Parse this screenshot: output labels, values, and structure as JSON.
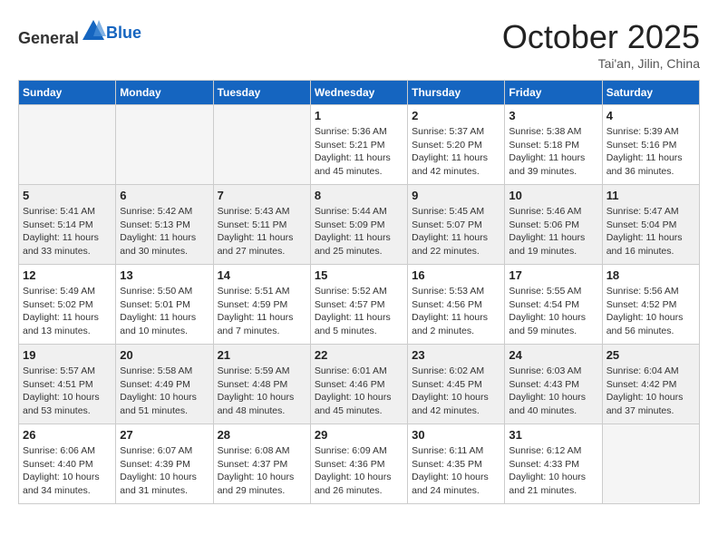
{
  "header": {
    "logo_general": "General",
    "logo_blue": "Blue",
    "month": "October 2025",
    "location": "Tai'an, Jilin, China"
  },
  "days_of_week": [
    "Sunday",
    "Monday",
    "Tuesday",
    "Wednesday",
    "Thursday",
    "Friday",
    "Saturday"
  ],
  "weeks": [
    [
      {
        "day": "",
        "sunrise": "",
        "sunset": "",
        "daylight": "",
        "empty": true
      },
      {
        "day": "",
        "sunrise": "",
        "sunset": "",
        "daylight": "",
        "empty": true
      },
      {
        "day": "",
        "sunrise": "",
        "sunset": "",
        "daylight": "",
        "empty": true
      },
      {
        "day": "1",
        "sunrise": "Sunrise: 5:36 AM",
        "sunset": "Sunset: 5:21 PM",
        "daylight": "Daylight: 11 hours and 45 minutes.",
        "empty": false
      },
      {
        "day": "2",
        "sunrise": "Sunrise: 5:37 AM",
        "sunset": "Sunset: 5:20 PM",
        "daylight": "Daylight: 11 hours and 42 minutes.",
        "empty": false
      },
      {
        "day": "3",
        "sunrise": "Sunrise: 5:38 AM",
        "sunset": "Sunset: 5:18 PM",
        "daylight": "Daylight: 11 hours and 39 minutes.",
        "empty": false
      },
      {
        "day": "4",
        "sunrise": "Sunrise: 5:39 AM",
        "sunset": "Sunset: 5:16 PM",
        "daylight": "Daylight: 11 hours and 36 minutes.",
        "empty": false
      }
    ],
    [
      {
        "day": "5",
        "sunrise": "Sunrise: 5:41 AM",
        "sunset": "Sunset: 5:14 PM",
        "daylight": "Daylight: 11 hours and 33 minutes.",
        "empty": false
      },
      {
        "day": "6",
        "sunrise": "Sunrise: 5:42 AM",
        "sunset": "Sunset: 5:13 PM",
        "daylight": "Daylight: 11 hours and 30 minutes.",
        "empty": false
      },
      {
        "day": "7",
        "sunrise": "Sunrise: 5:43 AM",
        "sunset": "Sunset: 5:11 PM",
        "daylight": "Daylight: 11 hours and 27 minutes.",
        "empty": false
      },
      {
        "day": "8",
        "sunrise": "Sunrise: 5:44 AM",
        "sunset": "Sunset: 5:09 PM",
        "daylight": "Daylight: 11 hours and 25 minutes.",
        "empty": false
      },
      {
        "day": "9",
        "sunrise": "Sunrise: 5:45 AM",
        "sunset": "Sunset: 5:07 PM",
        "daylight": "Daylight: 11 hours and 22 minutes.",
        "empty": false
      },
      {
        "day": "10",
        "sunrise": "Sunrise: 5:46 AM",
        "sunset": "Sunset: 5:06 PM",
        "daylight": "Daylight: 11 hours and 19 minutes.",
        "empty": false
      },
      {
        "day": "11",
        "sunrise": "Sunrise: 5:47 AM",
        "sunset": "Sunset: 5:04 PM",
        "daylight": "Daylight: 11 hours and 16 minutes.",
        "empty": false
      }
    ],
    [
      {
        "day": "12",
        "sunrise": "Sunrise: 5:49 AM",
        "sunset": "Sunset: 5:02 PM",
        "daylight": "Daylight: 11 hours and 13 minutes.",
        "empty": false
      },
      {
        "day": "13",
        "sunrise": "Sunrise: 5:50 AM",
        "sunset": "Sunset: 5:01 PM",
        "daylight": "Daylight: 11 hours and 10 minutes.",
        "empty": false
      },
      {
        "day": "14",
        "sunrise": "Sunrise: 5:51 AM",
        "sunset": "Sunset: 4:59 PM",
        "daylight": "Daylight: 11 hours and 7 minutes.",
        "empty": false
      },
      {
        "day": "15",
        "sunrise": "Sunrise: 5:52 AM",
        "sunset": "Sunset: 4:57 PM",
        "daylight": "Daylight: 11 hours and 5 minutes.",
        "empty": false
      },
      {
        "day": "16",
        "sunrise": "Sunrise: 5:53 AM",
        "sunset": "Sunset: 4:56 PM",
        "daylight": "Daylight: 11 hours and 2 minutes.",
        "empty": false
      },
      {
        "day": "17",
        "sunrise": "Sunrise: 5:55 AM",
        "sunset": "Sunset: 4:54 PM",
        "daylight": "Daylight: 10 hours and 59 minutes.",
        "empty": false
      },
      {
        "day": "18",
        "sunrise": "Sunrise: 5:56 AM",
        "sunset": "Sunset: 4:52 PM",
        "daylight": "Daylight: 10 hours and 56 minutes.",
        "empty": false
      }
    ],
    [
      {
        "day": "19",
        "sunrise": "Sunrise: 5:57 AM",
        "sunset": "Sunset: 4:51 PM",
        "daylight": "Daylight: 10 hours and 53 minutes.",
        "empty": false
      },
      {
        "day": "20",
        "sunrise": "Sunrise: 5:58 AM",
        "sunset": "Sunset: 4:49 PM",
        "daylight": "Daylight: 10 hours and 51 minutes.",
        "empty": false
      },
      {
        "day": "21",
        "sunrise": "Sunrise: 5:59 AM",
        "sunset": "Sunset: 4:48 PM",
        "daylight": "Daylight: 10 hours and 48 minutes.",
        "empty": false
      },
      {
        "day": "22",
        "sunrise": "Sunrise: 6:01 AM",
        "sunset": "Sunset: 4:46 PM",
        "daylight": "Daylight: 10 hours and 45 minutes.",
        "empty": false
      },
      {
        "day": "23",
        "sunrise": "Sunrise: 6:02 AM",
        "sunset": "Sunset: 4:45 PM",
        "daylight": "Daylight: 10 hours and 42 minutes.",
        "empty": false
      },
      {
        "day": "24",
        "sunrise": "Sunrise: 6:03 AM",
        "sunset": "Sunset: 4:43 PM",
        "daylight": "Daylight: 10 hours and 40 minutes.",
        "empty": false
      },
      {
        "day": "25",
        "sunrise": "Sunrise: 6:04 AM",
        "sunset": "Sunset: 4:42 PM",
        "daylight": "Daylight: 10 hours and 37 minutes.",
        "empty": false
      }
    ],
    [
      {
        "day": "26",
        "sunrise": "Sunrise: 6:06 AM",
        "sunset": "Sunset: 4:40 PM",
        "daylight": "Daylight: 10 hours and 34 minutes.",
        "empty": false
      },
      {
        "day": "27",
        "sunrise": "Sunrise: 6:07 AM",
        "sunset": "Sunset: 4:39 PM",
        "daylight": "Daylight: 10 hours and 31 minutes.",
        "empty": false
      },
      {
        "day": "28",
        "sunrise": "Sunrise: 6:08 AM",
        "sunset": "Sunset: 4:37 PM",
        "daylight": "Daylight: 10 hours and 29 minutes.",
        "empty": false
      },
      {
        "day": "29",
        "sunrise": "Sunrise: 6:09 AM",
        "sunset": "Sunset: 4:36 PM",
        "daylight": "Daylight: 10 hours and 26 minutes.",
        "empty": false
      },
      {
        "day": "30",
        "sunrise": "Sunrise: 6:11 AM",
        "sunset": "Sunset: 4:35 PM",
        "daylight": "Daylight: 10 hours and 24 minutes.",
        "empty": false
      },
      {
        "day": "31",
        "sunrise": "Sunrise: 6:12 AM",
        "sunset": "Sunset: 4:33 PM",
        "daylight": "Daylight: 10 hours and 21 minutes.",
        "empty": false
      },
      {
        "day": "",
        "sunrise": "",
        "sunset": "",
        "daylight": "",
        "empty": true
      }
    ]
  ]
}
